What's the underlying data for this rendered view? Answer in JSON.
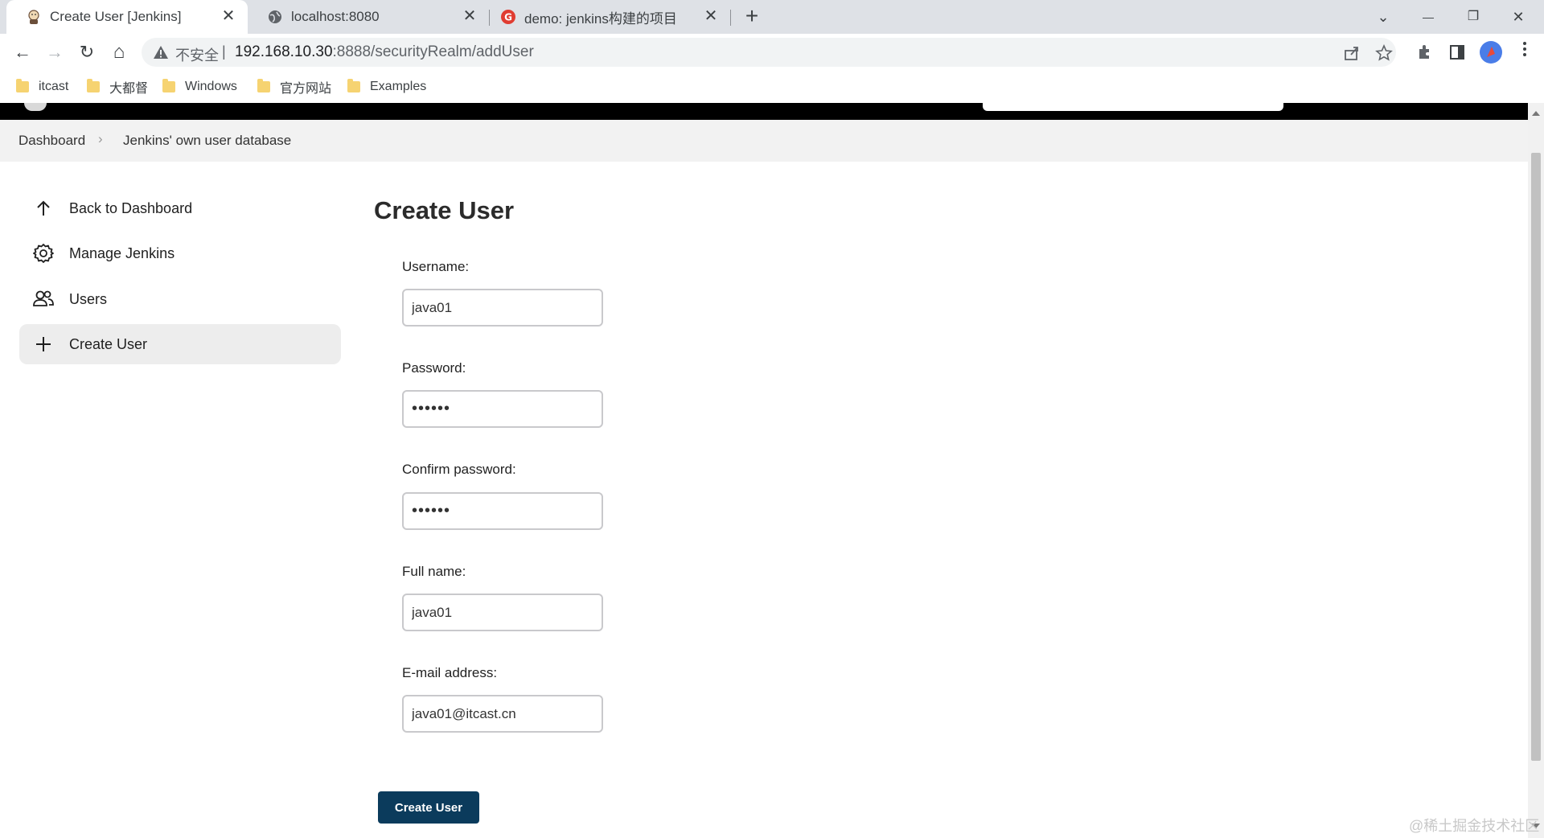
{
  "browser": {
    "tabs": [
      {
        "title": "Create User [Jenkins]",
        "close": "✕"
      },
      {
        "title": "localhost:8080",
        "close": "✕"
      },
      {
        "title": "demo: jenkins构建的项目",
        "close": "✕"
      }
    ],
    "new_tab": "+",
    "window": {
      "menu": "⌄",
      "minimize": "—",
      "restore": "❐",
      "close": "✕"
    },
    "nav": {
      "back": "←",
      "forward": "→",
      "reload": "↻",
      "home": "⌂"
    },
    "address": {
      "security": "不安全",
      "separator": "|",
      "host": "192.168.10.30",
      "rest": ":8888/securityRealm/addUser"
    },
    "bookmarks": [
      "itcast",
      "大都督",
      "Windows",
      "官方网站",
      "Examples"
    ]
  },
  "breadcrumbs": {
    "home": "Dashboard",
    "separator": "›",
    "current": "Jenkins' own user database"
  },
  "sidebar": {
    "items": [
      {
        "label": "Back to Dashboard",
        "icon": "arrow-up-icon"
      },
      {
        "label": "Manage Jenkins",
        "icon": "gear-icon"
      },
      {
        "label": "Users",
        "icon": "users-icon"
      },
      {
        "label": "Create User",
        "icon": "plus-icon"
      }
    ]
  },
  "form": {
    "title": "Create User",
    "username": {
      "label": "Username:",
      "value": "java01"
    },
    "password": {
      "label": "Password:",
      "value": "••••••"
    },
    "confirm_password": {
      "label": "Confirm password:",
      "value": "••••••"
    },
    "fullname": {
      "label": "Full name:",
      "value": "java01"
    },
    "email": {
      "label": "E-mail address:",
      "value": "java01@itcast.cn"
    },
    "submit": "Create User"
  },
  "watermark": "@稀土掘金技术社区",
  "colors": {
    "primary_button": "#0b3b5c",
    "header": "#000000",
    "breadcrumb_bg": "#f2f2f2",
    "active_sidebar": "#ededed"
  }
}
